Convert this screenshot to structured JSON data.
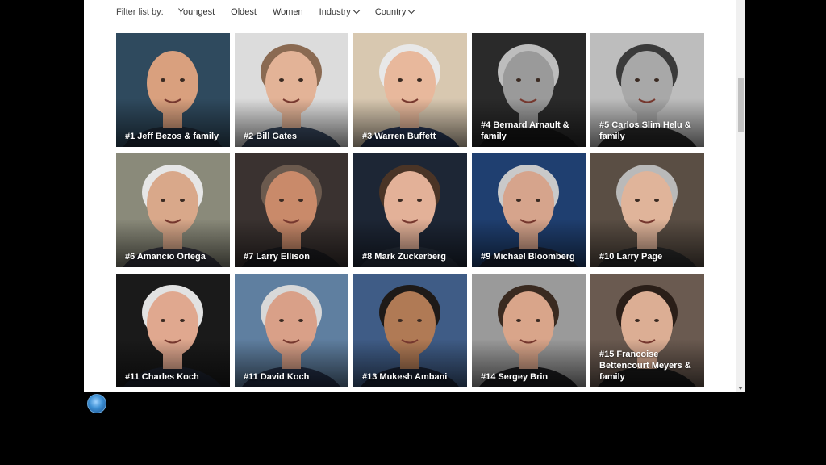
{
  "filter": {
    "label": "Filter list by:",
    "options": [
      "Youngest",
      "Oldest",
      "Women",
      "Industry",
      "Country"
    ]
  },
  "people": [
    {
      "label": "#1 Jeff Bezos & family",
      "bg": "#2f4a5e",
      "skin": "#d9a07e",
      "hair": "none",
      "shirt": "#1f2b3a"
    },
    {
      "label": "#2 Bill Gates",
      "bg": "#dcdcdc",
      "skin": "#e3b397",
      "hair": "#8a6a52",
      "shirt": "#3a4a62"
    },
    {
      "label": "#3 Warren Buffett",
      "bg": "#d8c8b0",
      "skin": "#e8b89c",
      "hair": "#e8e8e8",
      "shirt": "#2a3a5a"
    },
    {
      "label": "#4 Bernard Arnault & family",
      "bg": "#2a2a2a",
      "skin": "#9a9a9a",
      "hair": "#bdbdbd",
      "shirt": "#161616"
    },
    {
      "label": "#5 Carlos Slim Helu & family",
      "bg": "#bdbdbd",
      "skin": "#a8a8a8",
      "hair": "#3a3a3a",
      "shirt": "#2a2a2a"
    },
    {
      "label": "#6 Amancio Ortega",
      "bg": "#8a8a7a",
      "skin": "#d9a88a",
      "hair": "#e6e6e6",
      "shirt": "#3b3b45"
    },
    {
      "label": "#7 Larry Ellison",
      "bg": "#3a3230",
      "skin": "#c98a6a",
      "hair": "#6b5a4e",
      "shirt": "#1e1e22"
    },
    {
      "label": "#8 Mark Zuckerberg",
      "bg": "#1d2635",
      "skin": "#e3b198",
      "hair": "#4a3426",
      "shirt": "#2a3342"
    },
    {
      "label": "#9 Michael Bloomberg",
      "bg": "#1f3f70",
      "skin": "#d6a48c",
      "hair": "#c9c9c9",
      "shirt": "#1c2438"
    },
    {
      "label": "#10 Larry Page",
      "bg": "#5a4e44",
      "skin": "#e0b49a",
      "hair": "#b9b9b9",
      "shirt": "#2e2e2e"
    },
    {
      "label": "#11 Charles Koch",
      "bg": "#1a1a1a",
      "skin": "#e0a88f",
      "hair": "#e2e2e2",
      "shirt": "#1e2330"
    },
    {
      "label": "#11 David Koch",
      "bg": "#5f7fa0",
      "skin": "#d9a088",
      "hair": "#d8d8d8",
      "shirt": "#25314a"
    },
    {
      "label": "#13 Mukesh Ambani",
      "bg": "#3f5c86",
      "skin": "#b07a55",
      "hair": "#1e1a18",
      "shirt": "#1b2436"
    },
    {
      "label": "#14 Sergey Brin",
      "bg": "#9a9a9a",
      "skin": "#d9a58a",
      "hair": "#3a2a20",
      "shirt": "#1f1f22"
    },
    {
      "label": "#15 Francoise Bettencourt Meyers & family",
      "bg": "#6a5a50",
      "skin": "#dcae94",
      "hair": "#2a1e18",
      "shirt": "#1a1a1a"
    }
  ]
}
